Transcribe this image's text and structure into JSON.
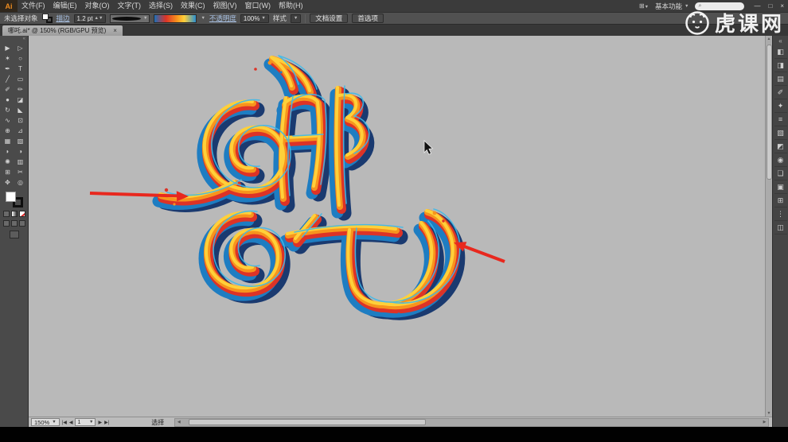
{
  "watermark": {
    "text": "虎课网"
  },
  "menubar": {
    "logo_text": "Ai",
    "menus": [
      {
        "name": "menu-file",
        "label": "文件(F)"
      },
      {
        "name": "menu-edit",
        "label": "编辑(E)"
      },
      {
        "name": "menu-object",
        "label": "对象(O)"
      },
      {
        "name": "menu-type",
        "label": "文字(T)"
      },
      {
        "name": "menu-select",
        "label": "选择(S)"
      },
      {
        "name": "menu-effect",
        "label": "效果(C)"
      },
      {
        "name": "menu-view",
        "label": "视图(V)"
      },
      {
        "name": "menu-window",
        "label": "窗口(W)"
      },
      {
        "name": "menu-help",
        "label": "帮助(H)"
      }
    ],
    "arrange_glyph": "⊞",
    "workspace_switcher": "基本功能",
    "search_icon_glyph": "⌕",
    "window_buttons": {
      "minimize": "—",
      "restore": "□",
      "close": "×"
    }
  },
  "controlbar": {
    "selection_status": "未选择对象",
    "stroke_label": "描边",
    "stroke_value": "1.2 pt",
    "opacity_label": "不透明度",
    "opacity_value": "100%",
    "style_label": "样式",
    "doc_setup_label": "文档设置",
    "preferences_label": "首选项"
  },
  "tabbar": {
    "document_title": "哪吒.ai* @ 150% (RGB/GPU 预览)",
    "close_glyph": "×"
  },
  "toolbar": {
    "collapse_glyph": "«",
    "tools": [
      {
        "name": "selection-tool",
        "glyph": "▶"
      },
      {
        "name": "direct-selection-tool",
        "glyph": "▷"
      },
      {
        "name": "magic-wand-tool",
        "glyph": "✶"
      },
      {
        "name": "lasso-tool",
        "glyph": "○"
      },
      {
        "name": "pen-tool",
        "glyph": "✒"
      },
      {
        "name": "type-tool",
        "glyph": "T"
      },
      {
        "name": "line-segment-tool",
        "glyph": "╱"
      },
      {
        "name": "rectangle-tool",
        "glyph": "▭"
      },
      {
        "name": "paintbrush-tool",
        "glyph": "✐"
      },
      {
        "name": "pencil-tool",
        "glyph": "✏"
      },
      {
        "name": "blob-brush-tool",
        "glyph": "●"
      },
      {
        "name": "eraser-tool",
        "glyph": "◪"
      },
      {
        "name": "rotate-tool",
        "glyph": "↻"
      },
      {
        "name": "scale-tool",
        "glyph": "◣"
      },
      {
        "name": "width-tool",
        "glyph": "∿"
      },
      {
        "name": "free-transform-tool",
        "glyph": "⊡"
      },
      {
        "name": "shape-builder-tool",
        "glyph": "⊕"
      },
      {
        "name": "perspective-grid-tool",
        "glyph": "⊿"
      },
      {
        "name": "mesh-tool",
        "glyph": "▦"
      },
      {
        "name": "gradient-tool",
        "glyph": "▧"
      },
      {
        "name": "eyedropper-tool",
        "glyph": "◗"
      },
      {
        "name": "blend-tool",
        "glyph": "◑"
      },
      {
        "name": "symbol-sprayer-tool",
        "glyph": "✺"
      },
      {
        "name": "column-graph-tool",
        "glyph": "▥"
      },
      {
        "name": "artboard-tool",
        "glyph": "⊞"
      },
      {
        "name": "slice-tool",
        "glyph": "✂"
      },
      {
        "name": "hand-tool",
        "glyph": "✥"
      },
      {
        "name": "zoom-tool",
        "glyph": "◎"
      }
    ]
  },
  "canvas": {
    "artwork_text": "哪吒"
  },
  "right_panel": {
    "expand_glyph": "«",
    "icons": [
      {
        "name": "color-panel-icon",
        "glyph": "◧"
      },
      {
        "name": "color-guide-panel-icon",
        "glyph": "◨"
      },
      {
        "name": "swatches-panel-icon",
        "glyph": "▤"
      },
      {
        "name": "brushes-panel-icon",
        "glyph": "✐"
      },
      {
        "name": "symbols-panel-icon",
        "glyph": "✦"
      },
      {
        "name": "stroke-panel-icon",
        "glyph": "≡"
      },
      {
        "name": "gradient-panel-icon",
        "glyph": "▧"
      },
      {
        "name": "transparency-panel-icon",
        "glyph": "◩"
      },
      {
        "name": "appearance-panel-icon",
        "glyph": "◉"
      },
      {
        "name": "graphic-styles-panel-icon",
        "glyph": "❏"
      },
      {
        "name": "layers-panel-icon",
        "glyph": "▣"
      },
      {
        "name": "artboards-panel-icon",
        "glyph": "⊞"
      },
      {
        "name": "align-panel-icon",
        "glyph": "⋮"
      },
      {
        "name": "pathfinder-panel-icon",
        "glyph": "◫"
      }
    ]
  },
  "statusbar": {
    "zoom_value": "150%",
    "nav_first": "|◀",
    "nav_prev": "◀",
    "artboard_value": "1",
    "nav_next": "▶",
    "nav_last": "▶|",
    "status_label": "选择"
  },
  "palette": {
    "navy": "#1a3a70",
    "blue": "#1e7dc2",
    "red": "#dd3327",
    "orange": "#f7941d",
    "yellow": "#ffd03a",
    "cyan": "#3fb9e9",
    "arrow_red": "#e8281e",
    "canvas_gray": "#b9b9b9"
  }
}
